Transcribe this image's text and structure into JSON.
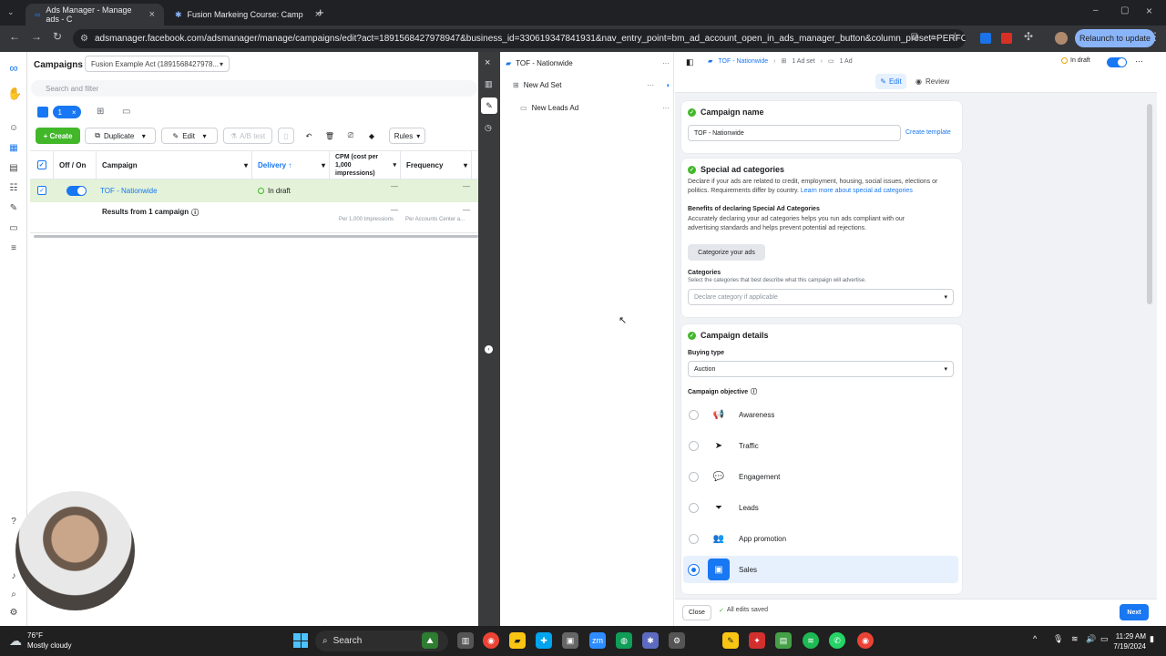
{
  "browser": {
    "tabs": [
      {
        "title": "Ads Manager - Manage ads - C",
        "active": true
      },
      {
        "title": "Fusion Markeing Course: Camp",
        "active": false
      }
    ],
    "url": "adsmanager.facebook.com/adsmanager/manage/campaigns/edit?act=1891568427978947&business_id=330619347841931&nav_entry_point=bm_ad_account_open_in_ads_manager_button&column_preset=PERFO...",
    "relaunch_label": "Relaunch to update"
  },
  "left": {
    "title": "Campaigns",
    "account": "Fusion Example Act (1891568427978...",
    "search_placeholder": "Search and filter",
    "selected_count": "1",
    "toolbar": {
      "create": "Create",
      "duplicate": "Duplicate",
      "edit": "Edit",
      "abtest": "A/B test",
      "rules": "Rules"
    },
    "columns": {
      "offon": "Off / On",
      "campaign": "Campaign",
      "delivery": "Delivery ↑",
      "cpm": "CPM (cost per 1,000 impressions)",
      "frequency": "Frequency"
    },
    "row": {
      "name": "TOF - Nationwide",
      "delivery": "In draft",
      "cpm": "—",
      "frequency": "—"
    },
    "results": {
      "label": "Results from 1 campaign",
      "cpm": "—",
      "cpm_sub": "Per 1,000 Impressions",
      "freq": "—",
      "freq_sub": "Per Accounts Center a..."
    }
  },
  "tree": {
    "campaign": "TOF - Nationwide",
    "adset": "New Ad Set",
    "ad": "New Leads Ad"
  },
  "editor": {
    "breadcrumb": {
      "campaign": "TOF - Nationwide",
      "adset": "1 Ad set",
      "ad": "1 Ad"
    },
    "status": "In draft",
    "tabs": {
      "edit": "Edit",
      "review": "Review"
    },
    "campaign_name": {
      "title": "Campaign name",
      "value": "TOF - Nationwide",
      "create_template": "Create template"
    },
    "special": {
      "title": "Special ad categories",
      "desc": "Declare if your ads are related to credit, employment, housing, social issues, elections or politics. Requirements differ by country.",
      "learn_more": "Learn more about special ad categories",
      "benefits_title": "Benefits of declaring Special Ad Categories",
      "benefits_text": "Accurately declaring your ad categories helps you run ads compliant with our advertising standards and helps prevent potential ad rejections.",
      "categorize_btn": "Categorize your ads",
      "categories_label": "Categories",
      "categories_help": "Select the categories that best describe what this campaign will advertise.",
      "categories_placeholder": "Declare category if applicable"
    },
    "details": {
      "title": "Campaign details",
      "buying_type_label": "Buying type",
      "buying_type": "Auction",
      "objective_label": "Campaign objective",
      "objectives": [
        {
          "label": "Awareness",
          "icon": "megaphone-icon",
          "selected": false
        },
        {
          "label": "Traffic",
          "icon": "cursor-icon",
          "selected": false
        },
        {
          "label": "Engagement",
          "icon": "chat-icon",
          "selected": false
        },
        {
          "label": "Leads",
          "icon": "funnel-icon",
          "selected": false
        },
        {
          "label": "App promotion",
          "icon": "people-icon",
          "selected": false
        },
        {
          "label": "Sales",
          "icon": "briefcase-icon",
          "selected": true
        }
      ]
    },
    "footer": {
      "close": "Close",
      "saved": "All edits saved",
      "next": "Next"
    }
  },
  "taskbar": {
    "weather_temp": "76°F",
    "weather_desc": "Mostly cloudy",
    "search": "Search",
    "time": "11:29 AM",
    "date": "7/19/2024"
  },
  "colors": {
    "accent": "#1877f2",
    "green": "#42b72a"
  }
}
